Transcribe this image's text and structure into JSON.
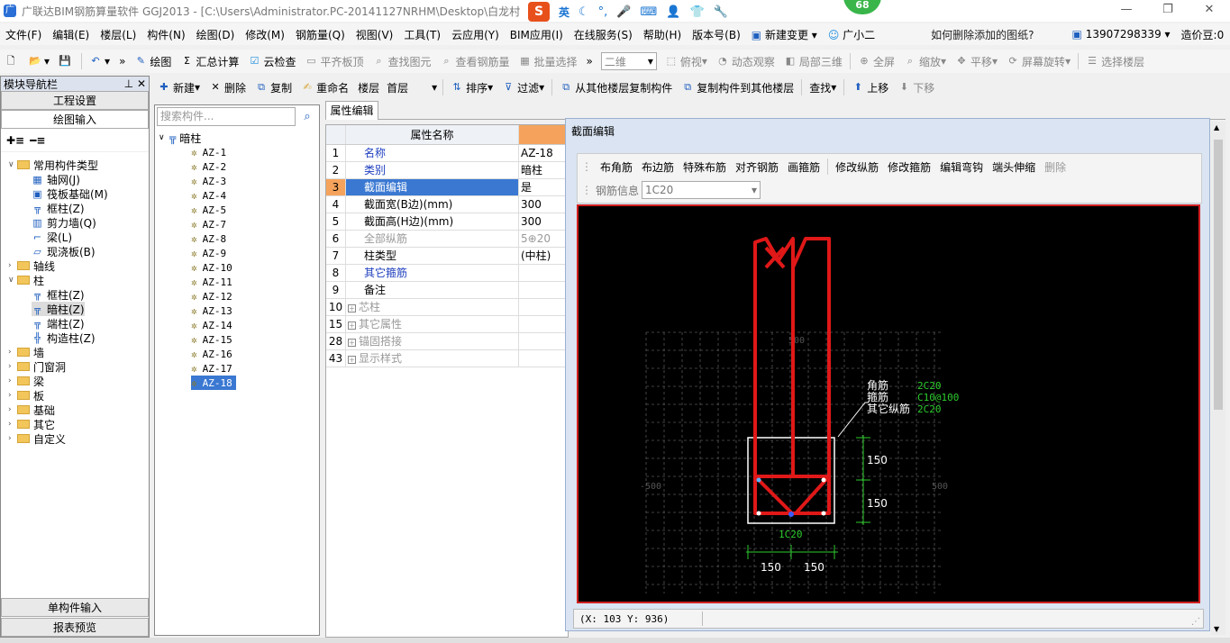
{
  "window": {
    "title": "广联达BIM钢筋算量软件 GGJ2013 - [C:\\Users\\Administrator.PC-20141127NRHM\\Desktop\\白龙村",
    "badge": "68",
    "ime_label": "英"
  },
  "menu": {
    "items": [
      "文件(F)",
      "编辑(E)",
      "楼层(L)",
      "构件(N)",
      "绘图(D)",
      "修改(M)",
      "钢筋量(Q)",
      "视图(V)",
      "工具(T)",
      "云应用(Y)",
      "BIM应用(I)",
      "在线服务(S)",
      "帮助(H)",
      "版本号(B)"
    ],
    "change": "新建变更",
    "assistant": "广小二",
    "help_question": "如何删除添加的图纸?",
    "phone": "13907298339",
    "bean_label": "造价豆:0"
  },
  "toolbar1": {
    "draw": "绘图",
    "sum": "汇总计算",
    "cloud_check": "云检查",
    "flat_slab": "平齐板顶",
    "find_elem": "查找图元",
    "view_rebar": "查看钢筋量",
    "batch_select": "批量选择",
    "view_mode": "二维",
    "top_view": "俯视",
    "dynamic": "动态观察",
    "local3d": "局部三维",
    "fullscreen": "全屏",
    "zoom": "缩放",
    "pan": "平移",
    "rotate": "屏幕旋转",
    "select_floor": "选择楼层"
  },
  "toolbar2": {
    "new": "新建",
    "delete": "删除",
    "copy": "复制",
    "rename": "重命名",
    "floor_label": "楼层",
    "floor_value": "首层",
    "sort": "排序",
    "filter": "过滤",
    "copy_from": "从其他楼层复制构件",
    "copy_to": "复制构件到其他楼层",
    "find": "查找",
    "up": "上移",
    "down": "下移"
  },
  "nav": {
    "title": "模块导航栏",
    "btn_project": "工程设置",
    "btn_draw": "绘图输入",
    "btn_single": "单构件输入",
    "btn_report": "报表预览",
    "tree": [
      {
        "label": "常用构件类型",
        "kind": "folder",
        "level": 0,
        "expanded": true
      },
      {
        "label": "轴网(J)",
        "kind": "grid",
        "level": 1
      },
      {
        "label": "筏板基础(M)",
        "kind": "raft",
        "level": 1
      },
      {
        "label": "框柱(Z)",
        "kind": "col",
        "level": 1
      },
      {
        "label": "剪力墙(Q)",
        "kind": "wall",
        "level": 1
      },
      {
        "label": "梁(L)",
        "kind": "beam",
        "level": 1
      },
      {
        "label": "现浇板(B)",
        "kind": "slab",
        "level": 1
      },
      {
        "label": "轴线",
        "kind": "folder",
        "level": 0
      },
      {
        "label": "柱",
        "kind": "folder",
        "level": 0,
        "expanded": true
      },
      {
        "label": "框柱(Z)",
        "kind": "col",
        "level": 1
      },
      {
        "label": "暗柱(Z)",
        "kind": "col",
        "level": 1,
        "selected": true
      },
      {
        "label": "端柱(Z)",
        "kind": "col",
        "level": 1
      },
      {
        "label": "构造柱(Z)",
        "kind": "gz",
        "level": 1
      },
      {
        "label": "墙",
        "kind": "folder",
        "level": 0
      },
      {
        "label": "门窗洞",
        "kind": "folder",
        "level": 0
      },
      {
        "label": "梁",
        "kind": "folder",
        "level": 0
      },
      {
        "label": "板",
        "kind": "folder",
        "level": 0
      },
      {
        "label": "基础",
        "kind": "folder",
        "level": 0
      },
      {
        "label": "其它",
        "kind": "folder",
        "level": 0
      },
      {
        "label": "自定义",
        "kind": "folder",
        "level": 0
      }
    ]
  },
  "component_list": {
    "search_placeholder": "搜索构件...",
    "root": "暗柱",
    "items": [
      "AZ-1",
      "AZ-2",
      "AZ-3",
      "AZ-4",
      "AZ-5",
      "AZ-7",
      "AZ-8",
      "AZ-9",
      "AZ-10",
      "AZ-11",
      "AZ-12",
      "AZ-13",
      "AZ-14",
      "AZ-15",
      "AZ-16",
      "AZ-17",
      "AZ-18"
    ],
    "selected": "AZ-18"
  },
  "properties": {
    "tab": "属性编辑",
    "header_name": "属性名称",
    "rows": [
      {
        "num": "1",
        "name": "名称",
        "value": "AZ-18",
        "style": "blue"
      },
      {
        "num": "2",
        "name": "类别",
        "value": "暗柱",
        "style": "blue"
      },
      {
        "num": "3",
        "name": "截面编辑",
        "value": "是",
        "style": "selected"
      },
      {
        "num": "4",
        "name": "截面宽(B边)(mm)",
        "value": "300",
        "style": "normal"
      },
      {
        "num": "5",
        "name": "截面高(H边)(mm)",
        "value": "300",
        "style": "normal"
      },
      {
        "num": "6",
        "name": "全部纵筋",
        "value": "5⊕20",
        "style": "grey"
      },
      {
        "num": "7",
        "name": "柱类型",
        "value": "(中柱)",
        "style": "normal"
      },
      {
        "num": "8",
        "name": "其它箍筋",
        "value": "",
        "style": "blue"
      },
      {
        "num": "9",
        "name": "备注",
        "value": "",
        "style": "normal"
      },
      {
        "num": "10",
        "name": "芯柱",
        "value": "",
        "style": "group"
      },
      {
        "num": "15",
        "name": "其它属性",
        "value": "",
        "style": "group"
      },
      {
        "num": "28",
        "name": "锚固搭接",
        "value": "",
        "style": "group"
      },
      {
        "num": "43",
        "name": "显示样式",
        "value": "",
        "style": "group"
      }
    ]
  },
  "section_editor": {
    "title": "截面编辑",
    "tools": [
      "布角筋",
      "布边筋",
      "特殊布筋",
      "对齐钢筋",
      "画箍筋",
      "修改纵筋",
      "修改箍筋",
      "编辑弯钩",
      "端头伸缩",
      "删除"
    ],
    "rebar_info_label": "钢筋信息",
    "rebar_info_value": "1C20",
    "legend": [
      {
        "label": "角筋",
        "value": "2C20"
      },
      {
        "label": "箍筋",
        "value": "C10@100"
      },
      {
        "label": "其它纵筋",
        "value": "2C20"
      }
    ],
    "dim_150_a": "150",
    "dim_150_b": "150",
    "dim_150_c": "150",
    "dim_150_d": "150",
    "bottom_rebar": "1C20",
    "grid_top": "500",
    "grid_left": "-500",
    "grid_right": "500",
    "coords": "(X: 103 Y: 936)",
    "colors": {
      "rebar": "#e01818",
      "dim": "#2ecc2e",
      "grid": "#5a5a5a",
      "frame": "#d21f1f"
    }
  }
}
